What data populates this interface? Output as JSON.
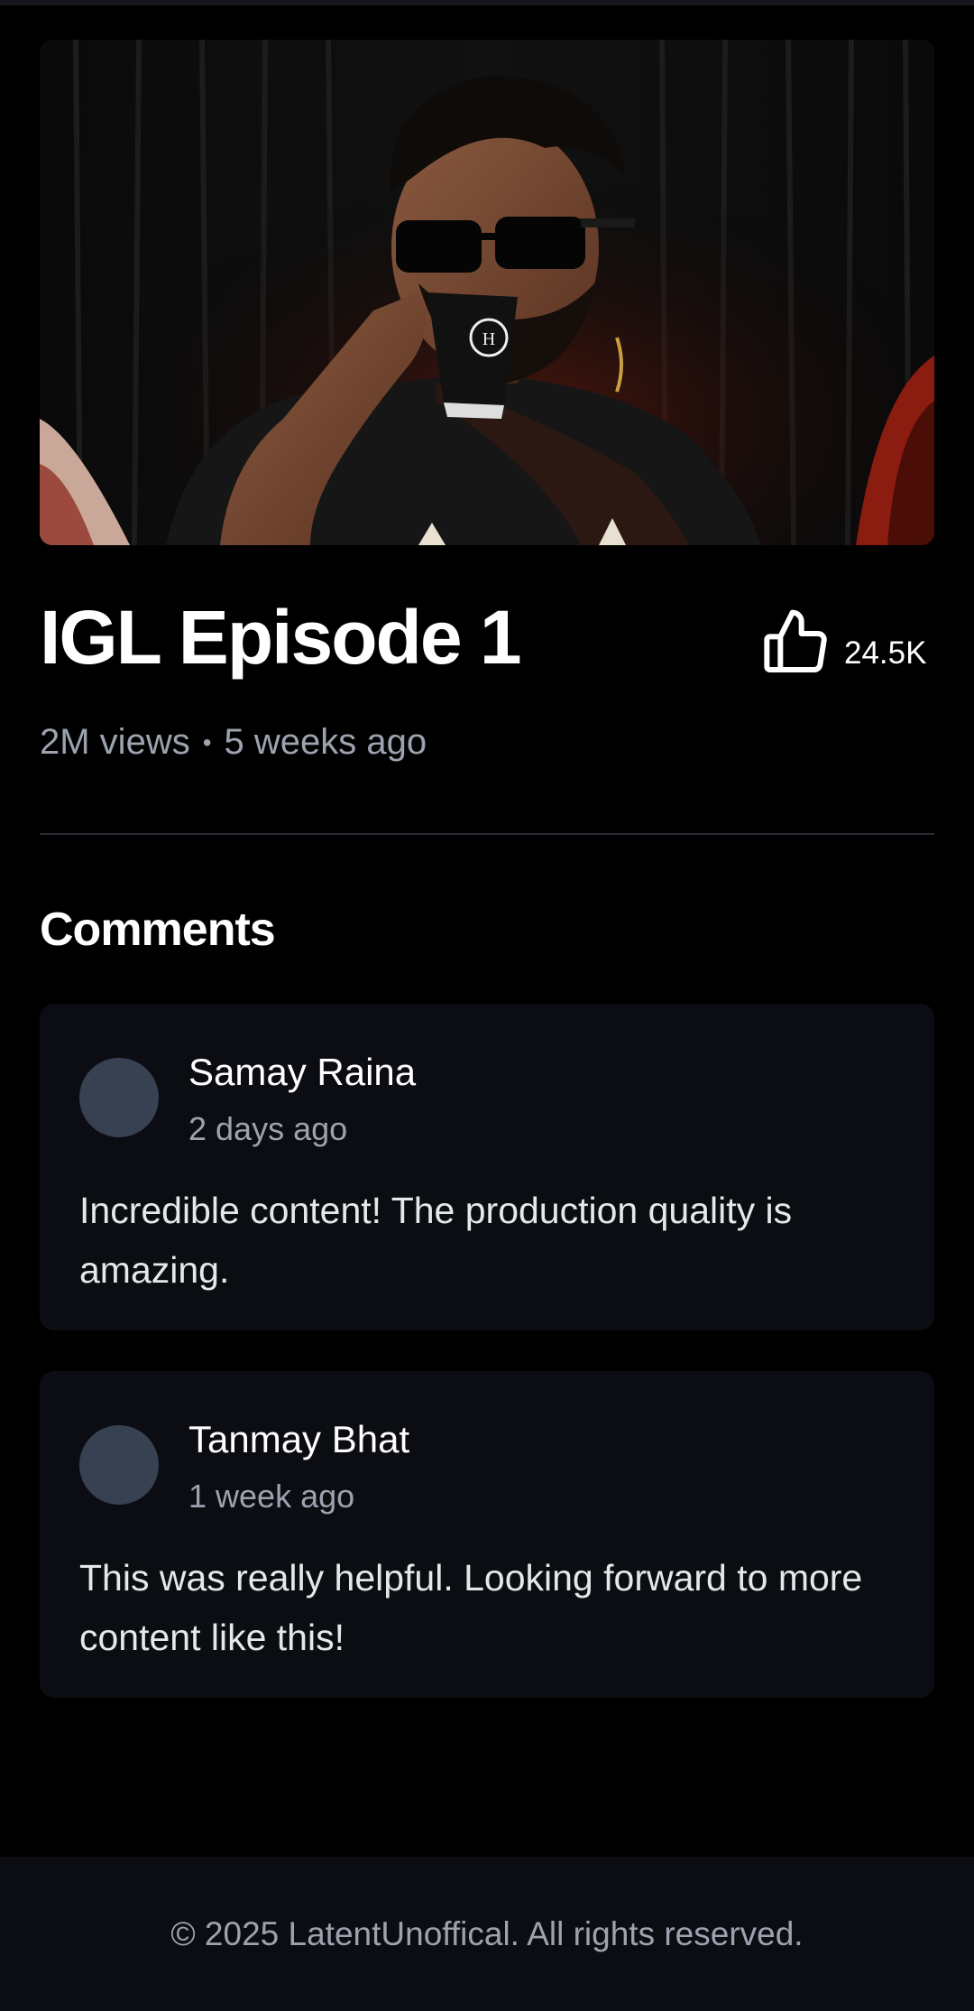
{
  "video": {
    "title": "IGL Episode 1",
    "likes": "24.5K",
    "views": "2M views",
    "separator": "•",
    "posted": "5 weeks ago",
    "like_icon": "thumbs-up-icon"
  },
  "comments": {
    "heading": "Comments",
    "items": [
      {
        "author": "Samay Raina",
        "time": "2 days ago",
        "text": "Incredible content! The production quality is amazing."
      },
      {
        "author": "Tanmay Bhat",
        "time": "1 week ago",
        "text": "This was really helpful. Looking forward to more content like this!"
      }
    ]
  },
  "footer": {
    "text": "© 2025 LatentUnoffical. All rights reserved."
  },
  "colors": {
    "background": "#000000",
    "card": "#0b0d13",
    "avatar": "#374151",
    "muted_text": "#9ca3af"
  }
}
